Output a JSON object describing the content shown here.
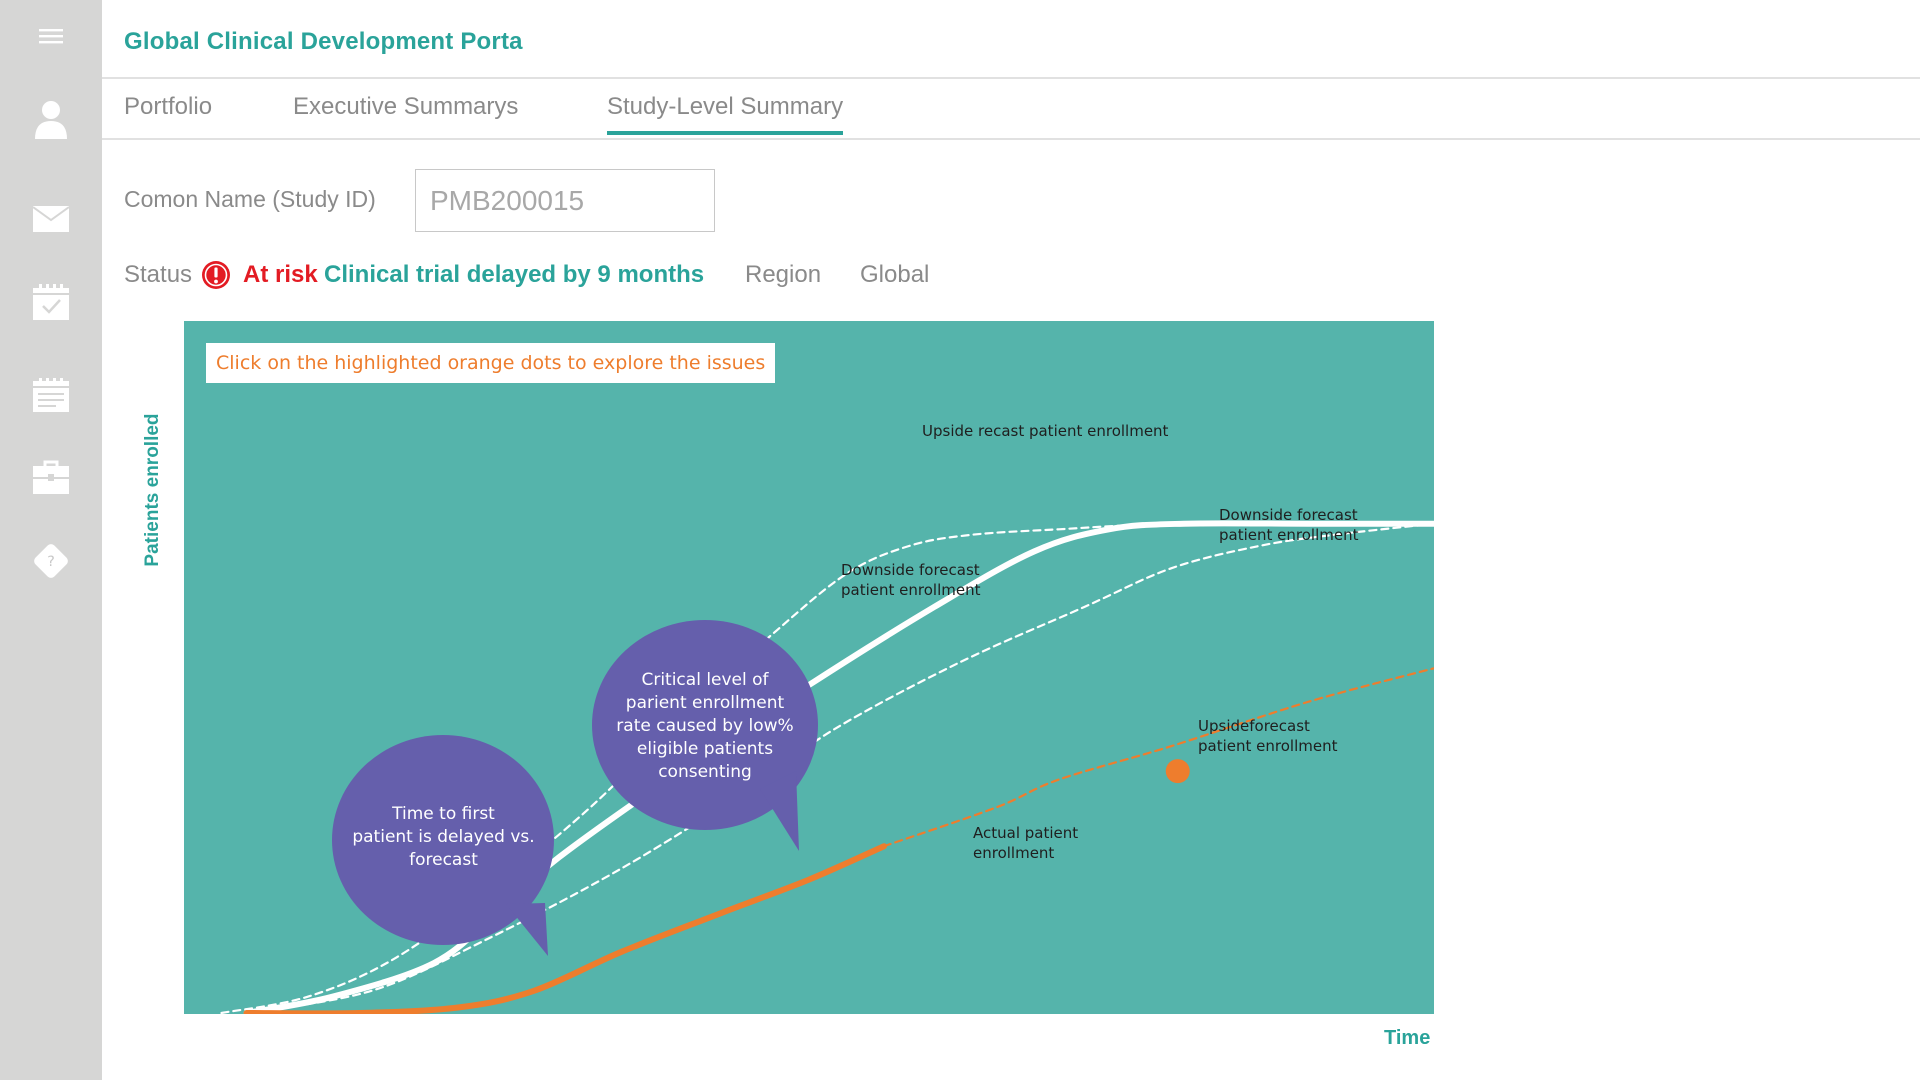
{
  "app": {
    "title": "Global Clinical Development Porta"
  },
  "sidebar": {
    "icons": [
      "menu-icon",
      "user-icon",
      "mail-icon",
      "calendar-check-icon",
      "calendar-list-icon",
      "briefcase-icon",
      "help-icon"
    ]
  },
  "tabs": [
    {
      "label": "Portfolio",
      "active": false
    },
    {
      "label": "Executive Summarys",
      "active": false
    },
    {
      "label": "Study-Level Summary",
      "active": true
    }
  ],
  "study": {
    "label": "Comon Name (Study ID)",
    "value": "PMB200015"
  },
  "status": {
    "label": "Status",
    "risk": "At risk",
    "delay": "Clinical trial delayed by 9 months",
    "region_label": "Region",
    "region_value": "Global"
  },
  "colors": {
    "accent": "#2aa39a",
    "chart_bg": "#55b4ab",
    "orange": "#ee7d2d",
    "risk_red": "#e31b23",
    "bubble": "#655fac"
  },
  "chart_data": {
    "type": "line",
    "hint": "Click on the highlighted orange dots to explore the issues",
    "xlabel": "Time",
    "ylabel": "Patients enrolled",
    "xlim": [
      0,
      100
    ],
    "ylim": [
      0,
      100
    ],
    "series": [
      {
        "name": "Upside recast patient enrollment",
        "style": "dashed-white",
        "x": [
          3,
          10,
          17,
          25,
          33,
          40,
          47,
          53,
          58,
          63,
          70,
          80,
          100
        ],
        "y": [
          0,
          3,
          10,
          23,
          38,
          54,
          68,
          79,
          84,
          86,
          87,
          88,
          88
        ]
      },
      {
        "name": "Forecast patient enrollment",
        "style": "solid-white",
        "x": [
          5,
          12,
          20,
          25,
          30,
          40,
          50,
          60,
          68,
          74,
          80,
          90,
          100
        ],
        "y": [
          0,
          3,
          9,
          18,
          28,
          44,
          59,
          73,
          83,
          87,
          88,
          88,
          88
        ]
      },
      {
        "name": "Downside forecast patient enrollment",
        "style": "dashed-white",
        "x": [
          5,
          15,
          24,
          35,
          45,
          52,
          62,
          72,
          79,
          86,
          92,
          100
        ],
        "y": [
          0,
          4,
          13,
          26,
          40,
          51,
          63,
          73,
          80,
          84,
          86,
          88
        ]
      },
      {
        "name": "Actual patient enrollment",
        "style": "solid-orange",
        "x": [
          5,
          14,
          22,
          28,
          35,
          43,
          50,
          56
        ],
        "y": [
          0,
          0,
          1,
          4,
          11,
          18,
          24,
          30
        ]
      },
      {
        "name": "Upsideforecast patient enrollment",
        "style": "dashed-orange",
        "x": [
          56,
          65,
          70,
          79,
          90,
          100
        ],
        "y": [
          30,
          37,
          42,
          48,
          56,
          62
        ]
      }
    ],
    "markers": [
      {
        "x": 79.5,
        "y": 43.5,
        "series": "Upsideforecast patient enrollment"
      }
    ],
    "annotations": [
      {
        "lines": [
          "Upside recast patient enrollment"
        ]
      },
      {
        "lines": [
          "Downside forecast",
          "patient enrollment"
        ]
      },
      {
        "lines": [
          "Downside forecast",
          "patient enrollment"
        ]
      },
      {
        "lines": [
          "Upsideforecast",
          "patient enrollment"
        ]
      },
      {
        "lines": [
          "Actual patient",
          "enrollment"
        ]
      }
    ],
    "callouts": [
      {
        "lines": [
          "Time to first",
          "patient is delayed vs.",
          "forecast"
        ]
      },
      {
        "lines": [
          "Critical level of",
          "parient enrollment",
          "rate caused by low%",
          "eligible patients",
          "consenting"
        ]
      }
    ]
  }
}
